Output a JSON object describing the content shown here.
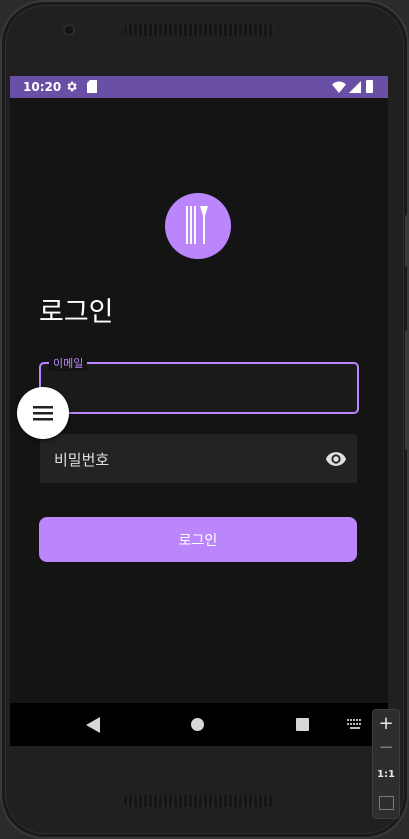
{
  "status_bar": {
    "time": "10:20",
    "icons": [
      "gear-icon",
      "sd-card-icon",
      "wifi-icon",
      "signal-icon",
      "battery-icon"
    ],
    "color": "#6a4fa6"
  },
  "app": {
    "logo_icon": "fork-knife-icon",
    "title": "로그인",
    "email_label": "이메일",
    "email_value": "",
    "password_placeholder": "비밀번호",
    "login_button_label": "로그인",
    "accent_color": "#bb86fc",
    "background_color": "#141414"
  },
  "fab": {
    "icon": "menu-icon"
  },
  "nav_bar": {
    "icons": [
      "back-icon",
      "home-icon",
      "recent-apps-icon",
      "keyboard-icon"
    ]
  },
  "emulator_toolbar": {
    "zoom_in_label": "+",
    "zoom_out_label": "−",
    "zoom_reset_label": "1:1",
    "fit_icon": "fit-screen-icon"
  }
}
